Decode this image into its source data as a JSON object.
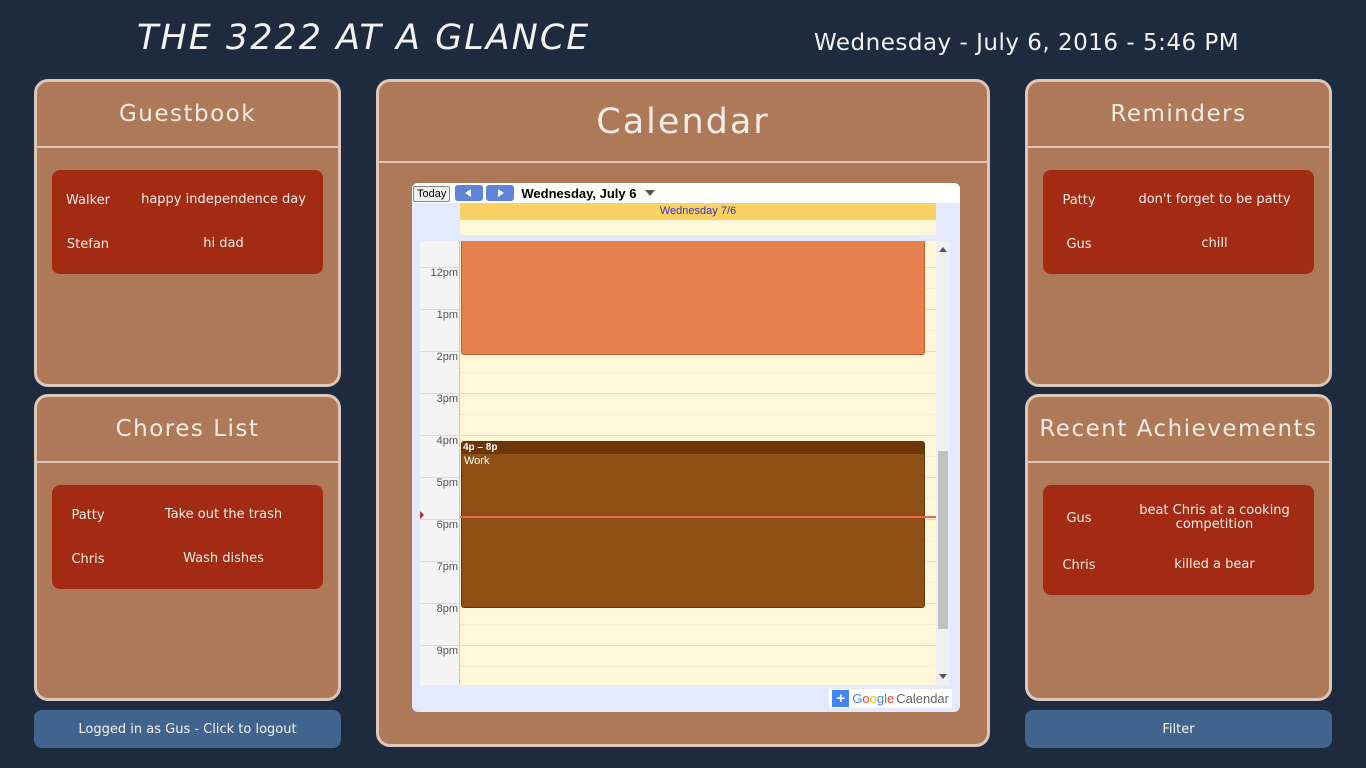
{
  "header": {
    "title": "THE 3222 AT A GLANCE",
    "datetime": "Wednesday - July 6, 2016 - 5:46 PM"
  },
  "guestbook": {
    "title": "Guestbook",
    "entries": [
      {
        "name": "Walker",
        "message": "happy independence day"
      },
      {
        "name": "Stefan",
        "message": "hi dad"
      }
    ]
  },
  "chores": {
    "title": "Chores List",
    "entries": [
      {
        "name": "Patty",
        "task": "Take out the trash"
      },
      {
        "name": "Chris",
        "task": "Wash dishes"
      }
    ]
  },
  "reminders": {
    "title": "Reminders",
    "entries": [
      {
        "name": "Patty",
        "message": "don't forget to be patty"
      },
      {
        "name": "Gus",
        "message": "chill"
      }
    ]
  },
  "achievements": {
    "title": "Recent Achievements",
    "entries": [
      {
        "name": "Gus",
        "message": "beat Chris at a cooking competition"
      },
      {
        "name": "Chris",
        "message": "killed a bear"
      }
    ]
  },
  "calendar": {
    "title": "Calendar",
    "today_label": "Today",
    "current_date": "Wednesday, July 6",
    "day_header": "Wednesday 7/6",
    "hours": [
      "12pm",
      "1pm",
      "2pm",
      "3pm",
      "4pm",
      "5pm",
      "6pm",
      "7pm",
      "8pm",
      "9pm"
    ],
    "events": [
      {
        "time": "4p – 8p",
        "title": "Work",
        "color": "#904f15"
      }
    ],
    "morning_event_color": "#e6804c",
    "footer_brand_google": "Google",
    "footer_brand_calendar": "Calendar"
  },
  "footer": {
    "logout_label": "Logged in as Gus - Click to logout",
    "filter_label": "Filter"
  }
}
